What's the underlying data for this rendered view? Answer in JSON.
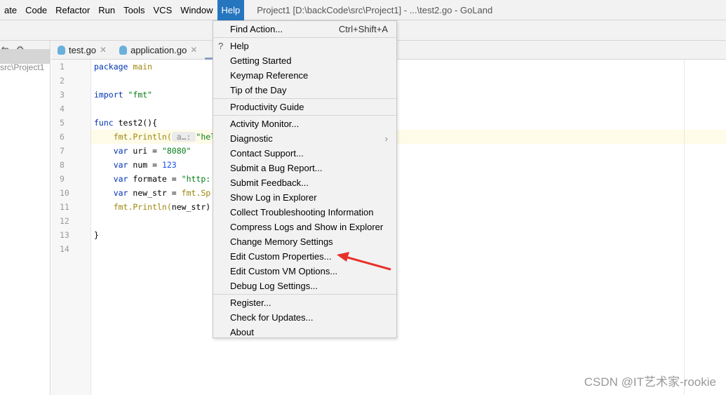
{
  "menubar": {
    "items": [
      "ate",
      "Code",
      "Refactor",
      "Run",
      "Tools",
      "VCS",
      "Window",
      "Help"
    ],
    "active": "Help",
    "title": "Project1 [D:\\backCode\\src\\Project1] - ...\\test2.go - GoLand"
  },
  "left_panel": {
    "path": "src\\Project1",
    "icons": [
      "collapse-icon",
      "gear-icon",
      "minimize-icon"
    ]
  },
  "tabs": [
    {
      "label": "test.go",
      "icon": "gopher-icon"
    },
    {
      "label": "application.go",
      "icon": "gopher-icon"
    }
  ],
  "editor": {
    "line_numbers": [
      "1",
      "2",
      "3",
      "4",
      "5",
      "6",
      "7",
      "8",
      "9",
      "10",
      "11",
      "12",
      "13",
      "14"
    ],
    "highlighted_line": 6,
    "lines": [
      [
        [
          "package ",
          "#0033b3"
        ],
        [
          "main",
          "#9e880d"
        ]
      ],
      [],
      [
        [
          "import ",
          "#0033b3"
        ],
        [
          "\"fmt\"",
          "#067d17"
        ]
      ],
      [],
      [
        [
          "func ",
          "#0033b3"
        ],
        [
          "test2(){",
          "#000"
        ]
      ],
      [
        [
          "    fmt.Println(",
          "#9e880d"
        ],
        [
          " a…: ",
          "#888"
        ],
        [
          "\"hel",
          "#067d17"
        ]
      ],
      [
        [
          "    var ",
          "#0033b3"
        ],
        [
          "uri = ",
          "#000"
        ],
        [
          "\"8080\"",
          "#067d17"
        ]
      ],
      [
        [
          "    var ",
          "#0033b3"
        ],
        [
          "num = ",
          "#000"
        ],
        [
          "123",
          "#1750eb"
        ]
      ],
      [
        [
          "    var ",
          "#0033b3"
        ],
        [
          "formate = ",
          "#000"
        ],
        [
          "\"http:",
          "#067d17"
        ]
      ],
      [
        [
          "    var ",
          "#0033b3"
        ],
        [
          "new_str = ",
          "#000"
        ],
        [
          "fmt.Sp",
          "#9e880d"
        ]
      ],
      [
        [
          "    fmt.Println(",
          "#9e880d"
        ],
        [
          "new_str)",
          "#000"
        ]
      ],
      [],
      [
        [
          "}",
          "#000"
        ]
      ],
      []
    ]
  },
  "help_menu": {
    "groups": [
      [
        {
          "label": "Find Action...",
          "shortcut": "Ctrl+Shift+A"
        }
      ],
      [
        {
          "label": "Help",
          "icon": "question-icon"
        },
        {
          "label": "Getting Started"
        },
        {
          "label": "Keymap Reference"
        },
        {
          "label": "Tip of the Day"
        }
      ],
      [
        {
          "label": "Productivity Guide"
        }
      ],
      [
        {
          "label": "Activity Monitor..."
        },
        {
          "label": "Diagnostic",
          "submenu": true
        },
        {
          "label": "Contact Support..."
        },
        {
          "label": "Submit a Bug Report..."
        },
        {
          "label": "Submit Feedback..."
        },
        {
          "label": "Show Log in Explorer"
        },
        {
          "label": "Collect Troubleshooting Information"
        },
        {
          "label": "Compress Logs and Show in Explorer"
        },
        {
          "label": "Change Memory Settings"
        },
        {
          "label": "Edit Custom Properties..."
        },
        {
          "label": "Edit Custom VM Options..."
        },
        {
          "label": "Debug Log Settings..."
        }
      ],
      [
        {
          "label": "Register..."
        },
        {
          "label": "Check for Updates..."
        },
        {
          "label": "About"
        }
      ]
    ]
  },
  "annotation": {
    "color": "#e8302a",
    "points_to": "Edit Custom Properties..."
  },
  "watermark": "CSDN @IT艺术家-rookie"
}
